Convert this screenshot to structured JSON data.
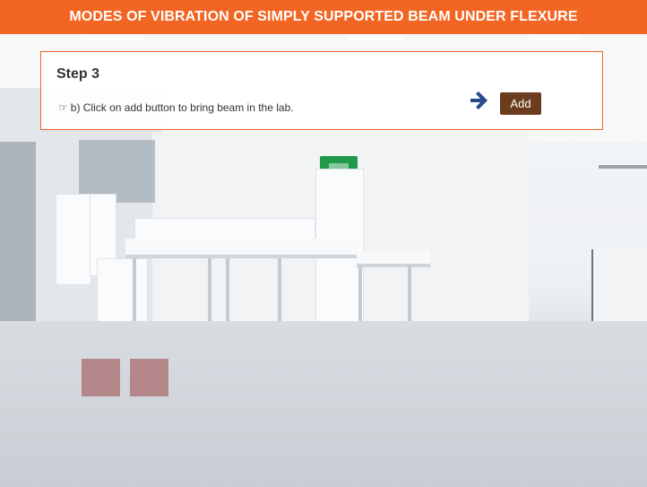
{
  "header": {
    "title": "MODES OF VIBRATION OF SIMPLY SUPPORTED BEAM UNDER FLEXURE"
  },
  "step": {
    "title": "Step 3",
    "instruction": "b) Click on add button to bring beam in the lab.",
    "pointer_icon": "hand-pointing-right-icon",
    "arrow_icon": "arrow-right-icon",
    "add_label": "Add"
  },
  "colors": {
    "header_bg": "#f26522",
    "card_border": "#f26522",
    "add_button_bg": "#6b3d1e",
    "arrow": "#2a4a8e",
    "block": "#b07e82"
  },
  "placeholders": [
    {
      "name": "beam-slot-1"
    },
    {
      "name": "beam-slot-2"
    }
  ]
}
